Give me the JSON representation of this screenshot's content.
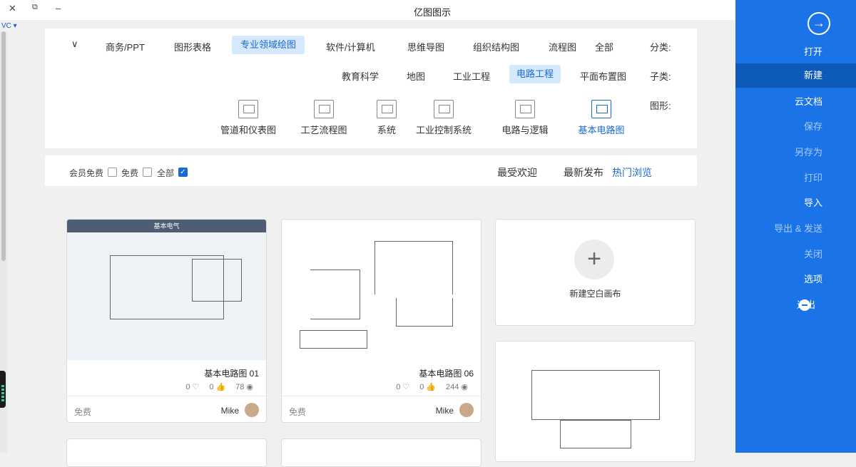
{
  "window": {
    "title": "亿图图示",
    "close": "✕",
    "restore": "⧉",
    "minimize": "‒",
    "vc": "VC ▾"
  },
  "categories": {
    "label": "分类:",
    "items": [
      "全部",
      "流程图",
      "组织结构图",
      "思维导图",
      "软件/计算机",
      "专业领域绘图",
      "图形表格",
      "商务/PPT"
    ],
    "selected": "专业领域绘图",
    "chevron": "∨"
  },
  "subcategories": {
    "label": "子类:",
    "items": [
      "平面布置图",
      "电路工程",
      "工业工程",
      "地图",
      "教育科学"
    ],
    "selected": "电路工程"
  },
  "shapes": {
    "label": "图形:",
    "items": [
      "基本电路图",
      "电路与逻辑",
      "工业控制系统",
      "系统",
      "工艺流程图",
      "管道和仪表图"
    ],
    "selected": "基本电路图"
  },
  "tabs": {
    "items": [
      "热门浏览",
      "最新发布",
      "最受欢迎"
    ],
    "active": "热门浏览"
  },
  "filters": {
    "all": "全部",
    "free": "免费",
    "member": "会员免费",
    "all_checked": true
  },
  "new_canvas": {
    "plus": "+",
    "label": "新建空白画布"
  },
  "cards": [
    {
      "title": "基本电路图 06",
      "views": "244",
      "likes": "0",
      "hearts": "0",
      "author": "Mike",
      "price": "免费"
    },
    {
      "title": "基本电路图 01",
      "views": "78",
      "likes": "0",
      "hearts": "0",
      "author": "Mike",
      "price": "免费",
      "header": "基本电气"
    }
  ],
  "sidebar": {
    "items": [
      "打开",
      "新建",
      "云文档",
      "保存",
      "另存为",
      "打印",
      "导入",
      "导出 & 发送",
      "关闭",
      "选项",
      "退出"
    ],
    "active": "新建"
  },
  "colors": {
    "accent": "#1b73e8",
    "selected": "#1b6ad1"
  }
}
